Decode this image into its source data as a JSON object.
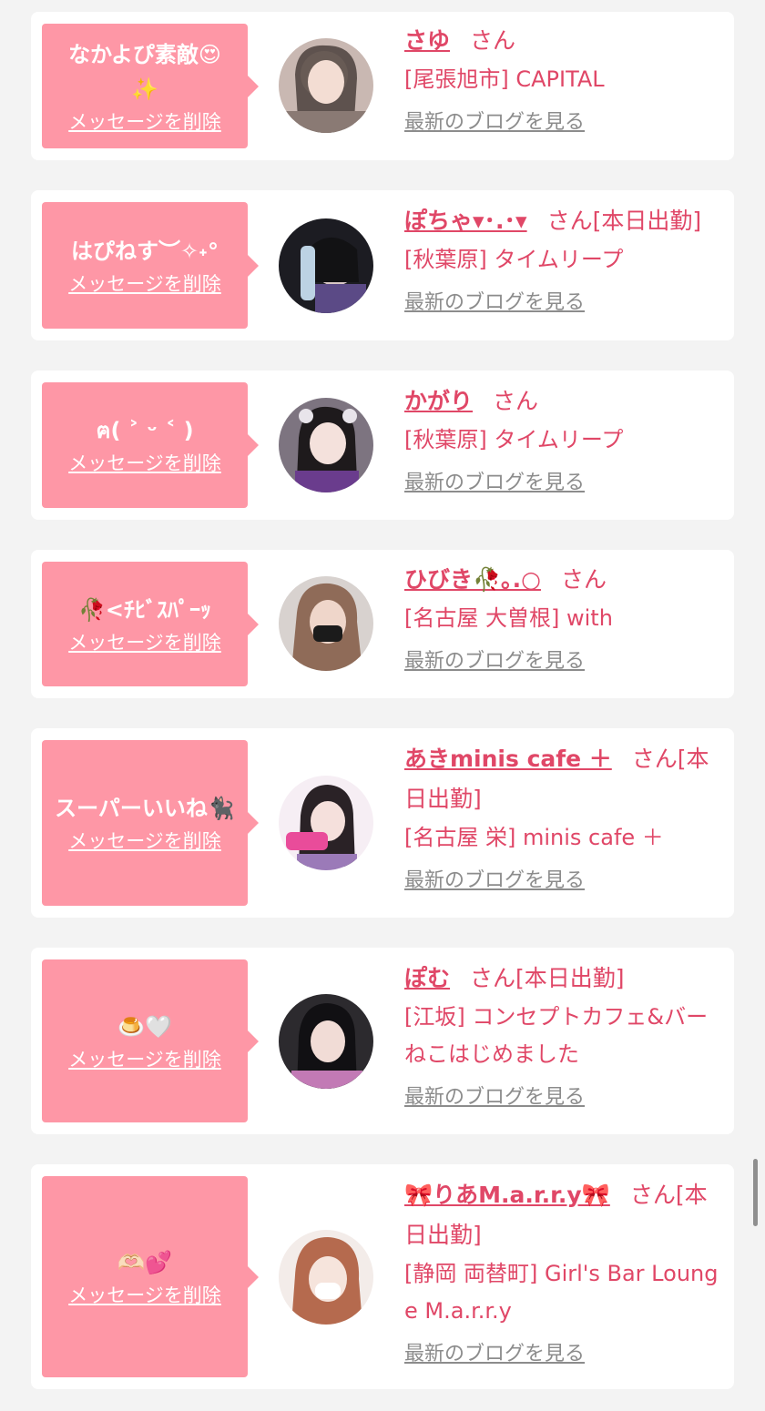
{
  "colors": {
    "background": "#f3f3f3",
    "card": "#ffffff",
    "bubble": "#fe97a6",
    "name_pink": "#e04767",
    "blog_gray": "#8c8c8c"
  },
  "delete_label": "メッセージを削除",
  "blog_label": "最新のブログを見る",
  "items": [
    {
      "message": "なかよぴ素敵😍\n✨",
      "name": "さゆ",
      "suffix": "さん",
      "shop": "[尾張旭市] CAPITAL",
      "avatar": "girl-photo"
    },
    {
      "message": "はぴねす︶✧˖°",
      "name": "ぽちゃ▾･.･▾",
      "suffix": "さん[本日出勤]",
      "shop": "[秋葉原] タイムリープ",
      "avatar": "girl-photo"
    },
    {
      "message": "ฅ( ˃ ᵕ ˂ )",
      "name": "かがり",
      "suffix": "さん",
      "shop": "[秋葉原] タイムリープ",
      "avatar": "girl-photo"
    },
    {
      "message": "🥀<ﾁﾋﾞｽﾊﾟｰｯ",
      "name": "ひびき🥀｡.○",
      "suffix": "さん",
      "shop": "[名古屋 大曽根] with",
      "avatar": "girl-photo"
    },
    {
      "message": "スーパーいいね🐈‍⬛",
      "name": "あきminis cafe ＋",
      "suffix": "さん[本日出勤]",
      "shop": "[名古屋 栄] minis cafe ＋",
      "avatar": "girl-photo"
    },
    {
      "message": "🍮🤍",
      "name": "ぽむ",
      "suffix": "さん[本日出勤]",
      "shop": "[江坂] コンセプトカフェ&バー　ねこはじめました",
      "avatar": "girl-photo"
    },
    {
      "message": "🫶🏻💕",
      "name": "🎀りあM.a.r.r.y🎀",
      "suffix": "さん[本日出勤]",
      "shop": "[静岡 両替町] Girl's Bar Lounge M.a.r.r.y",
      "avatar": "girl-photo"
    }
  ]
}
